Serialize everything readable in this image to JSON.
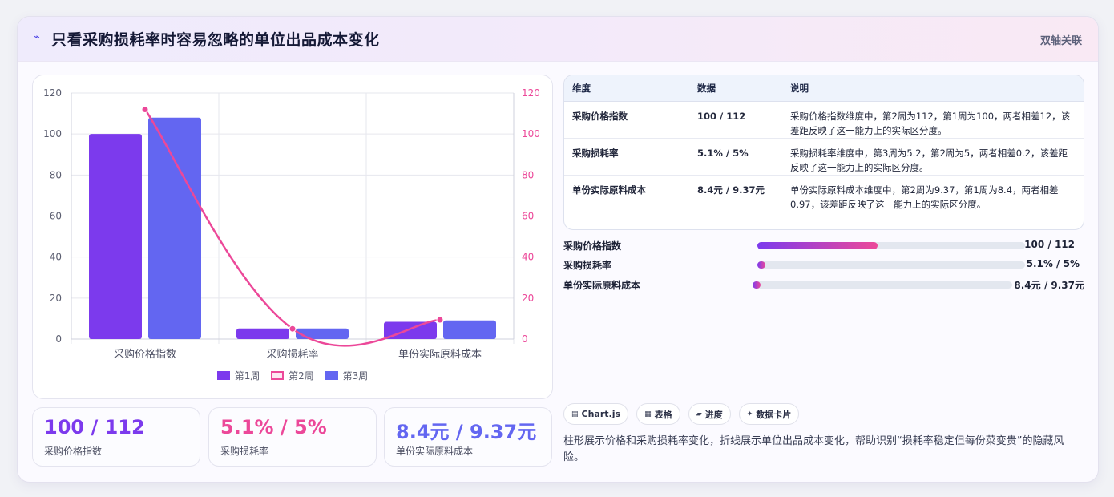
{
  "header": {
    "icon": "chart-line-icon",
    "title": "只看采购损耗率时容易忽略的单位出品成本变化",
    "tag": "双轴关联"
  },
  "chart_data": {
    "type": "bar",
    "categories": [
      "采购价格指数",
      "采购损耗率",
      "单份实际原料成本"
    ],
    "series": [
      {
        "name": "第1周",
        "kind": "bar",
        "axis": "left",
        "color": "#7c3aed",
        "values": [
          100,
          5.2,
          8.4
        ]
      },
      {
        "name": "第2周",
        "kind": "line",
        "axis": "right",
        "color": "#ec4899",
        "values": [
          112,
          5,
          9.37
        ]
      },
      {
        "name": "第3周",
        "kind": "bar",
        "axis": "left",
        "color": "#6366f1",
        "values": [
          108,
          5.2,
          9.1
        ]
      }
    ],
    "left_axis": {
      "ylim": [
        0,
        120
      ],
      "ticks": [
        "0",
        "20",
        "40",
        "60",
        "80",
        "100",
        "120"
      ]
    },
    "right_axis": {
      "ylim": [
        0,
        120
      ],
      "ticks": [
        "0",
        "20",
        "40",
        "60",
        "80",
        "100",
        "120"
      ]
    },
    "grid": true,
    "legend": "bottom"
  },
  "stats": [
    {
      "value": "100 / 112",
      "label": "采购价格指数",
      "color": "#7c3aed"
    },
    {
      "value": "5.1% / 5%",
      "label": "采购损耗率",
      "color": "#ec4899"
    },
    {
      "value": "8.4元 / 9.37元",
      "label": "单份实际原料成本",
      "color": "#6366f1"
    }
  ],
  "table": {
    "headers": [
      "维度",
      "数据",
      "说明"
    ],
    "rows": [
      {
        "name": "采购价格指数",
        "value": "100 / 112",
        "note": "采购价格指数维度中，第2周为112，第1周为100，两者相差12，该差距反映了这一能力上的实际区分度。"
      },
      {
        "name": "采购损耗率",
        "value": "5.1% / 5%",
        "note": "采购损耗率维度中，第3周为5.2，第2周为5，两者相差0.2，该差距反映了这一能力上的实际区分度。"
      },
      {
        "name": "单份实际原料成本",
        "value": "8.4元 / 9.37元",
        "note": "单份实际原料成本维度中，第2周为9.37，第1周为8.4，两者相差0.97，该差距反映了这一能力上的实际区分度。"
      }
    ]
  },
  "progress": [
    {
      "label": "采购价格指数",
      "value": "100 / 112",
      "fraction": 0.45
    },
    {
      "label": "采购损耗率",
      "value": "5.1% / 5%",
      "fraction": 0.03
    },
    {
      "label": "单份实际原料成本",
      "value": "8.4元 / 9.37元",
      "fraction": 0.03
    }
  ],
  "chips": [
    {
      "icon": "chart-icon",
      "glyph": "▤",
      "label": "Chart.js"
    },
    {
      "icon": "table-icon",
      "glyph": "▦",
      "label": "表格"
    },
    {
      "icon": "progress-icon",
      "glyph": "▰",
      "label": "进度"
    },
    {
      "icon": "sparkle-icon",
      "glyph": "✦",
      "label": "数据卡片"
    }
  ],
  "description": "柱形展示价格和采购损耗率变化，折线展示单位出品成本变化，帮助识别“损耗率稳定但每份菜变贵”的隐藏风险。"
}
